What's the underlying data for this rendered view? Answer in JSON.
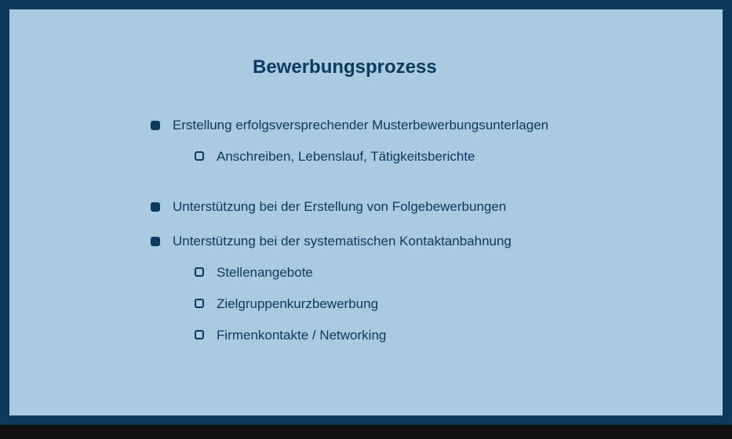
{
  "title": "Bewerbungsprozess",
  "items": [
    {
      "label": "Erstellung erfolgsversprechender Musterbewerbungsunterlagen",
      "subitems": [
        {
          "label": "Anschreiben, Lebenslauf, Tätigkeitsberichte"
        }
      ]
    },
    {
      "label": "Unterstützung bei der Erstellung von Folgebewerbungen",
      "subitems": []
    },
    {
      "label": "Unterstützung bei der systematischen Kontaktanbahnung",
      "subitems": [
        {
          "label": "Stellenangebote"
        },
        {
          "label": "Zielgruppenkurzbewerbung"
        },
        {
          "label": "Firmenkontakte / Networking"
        }
      ]
    }
  ]
}
